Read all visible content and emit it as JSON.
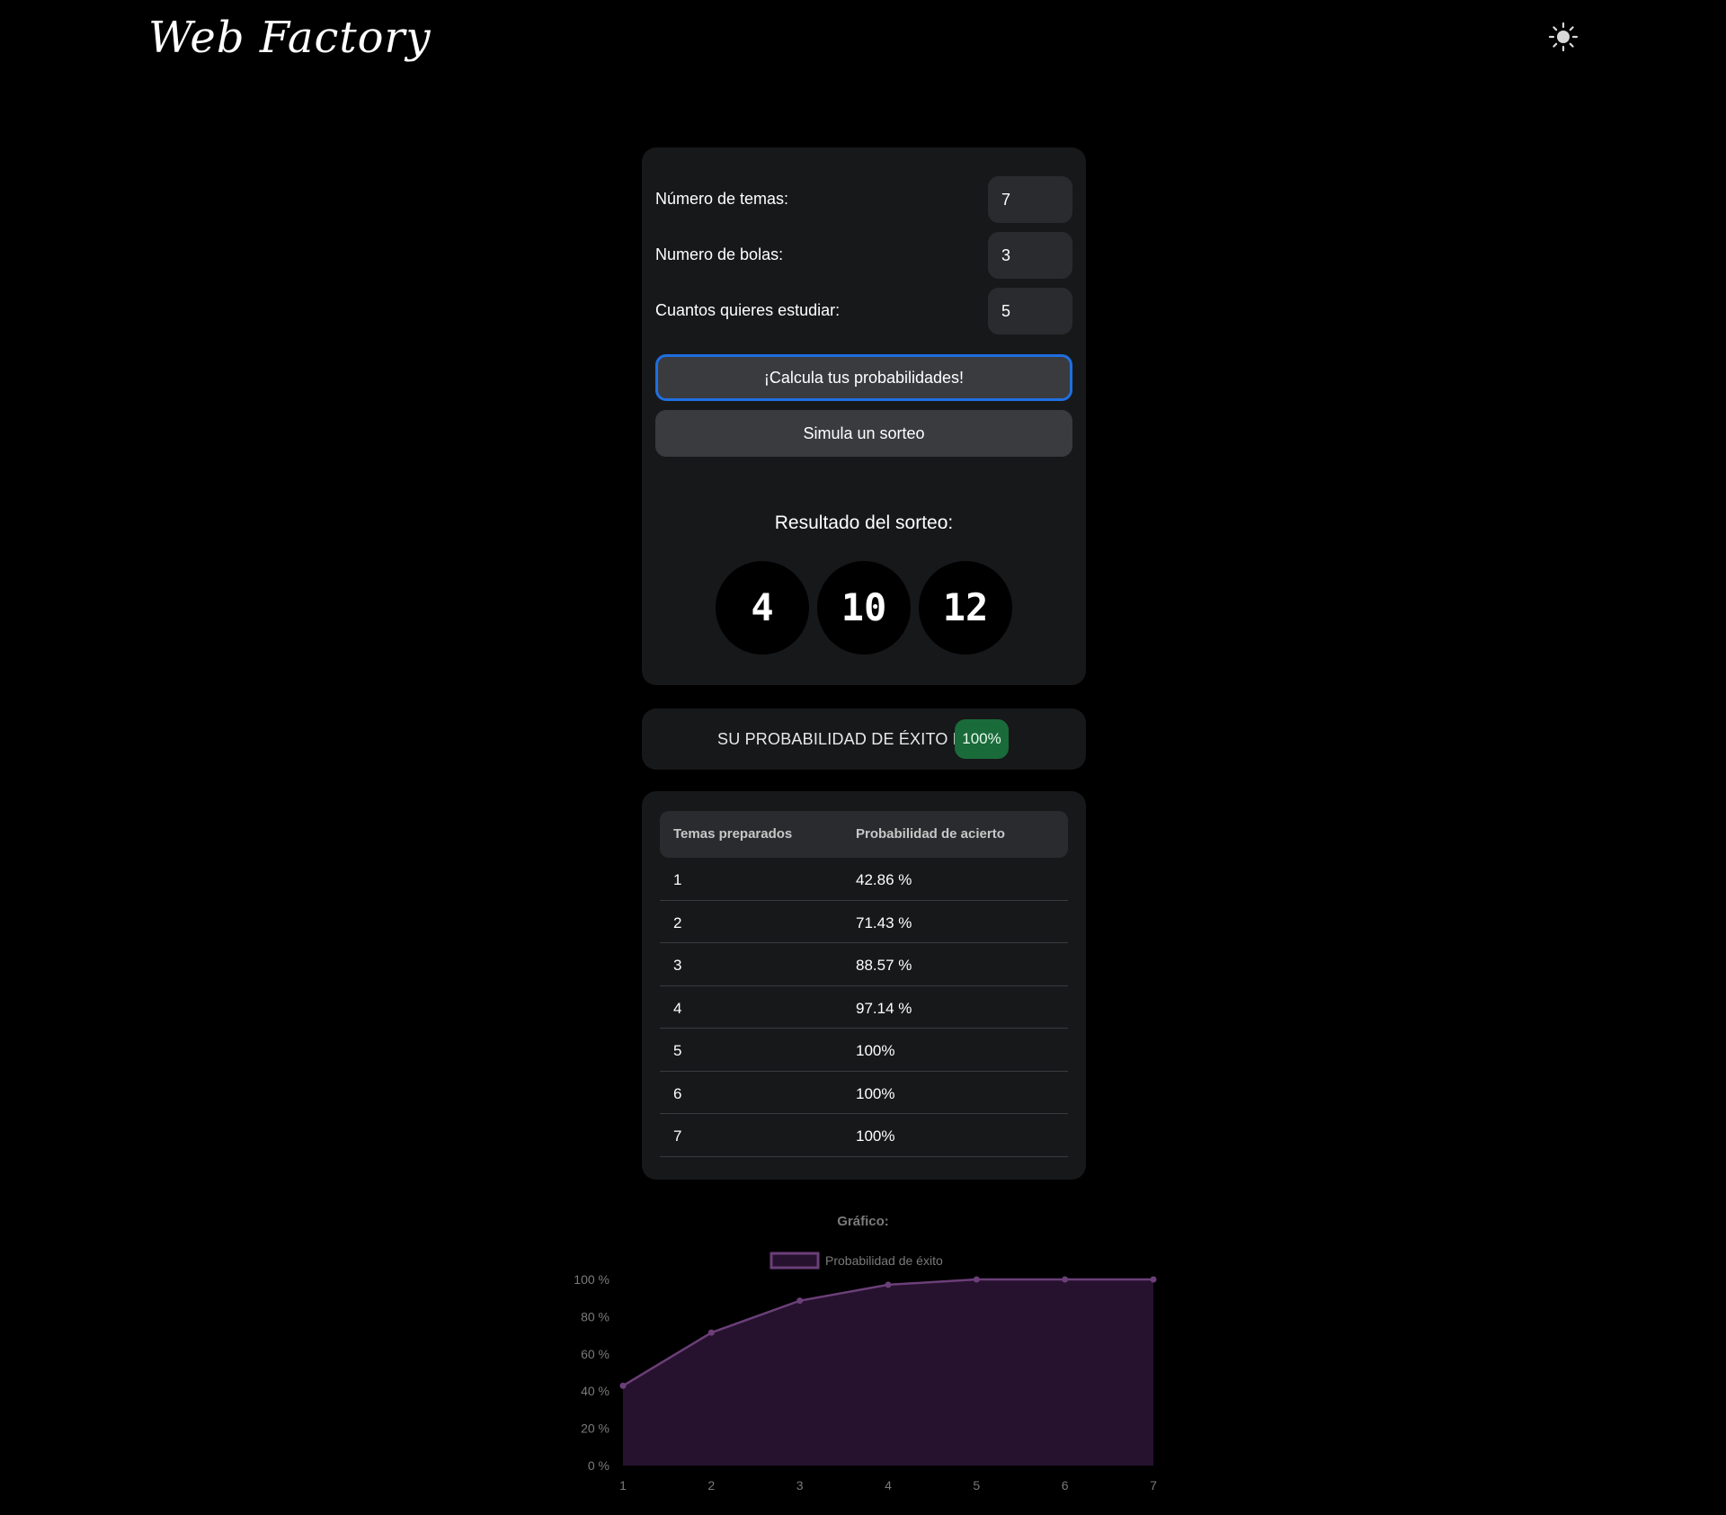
{
  "header": {
    "logo_text": "Web Factory",
    "theme_toggle_icon": "sun-icon"
  },
  "form": {
    "fields": [
      {
        "label": "Número de temas:",
        "value": "7"
      },
      {
        "label": "Numero de bolas:",
        "value": "3"
      },
      {
        "label": "Cuantos quieres estudiar:",
        "value": "5"
      }
    ],
    "calculate_label": "¡Calcula tus probabilidades!",
    "simulate_label": "Simula un sorteo",
    "accent_color": "#1f6fe0"
  },
  "draw": {
    "title": "Resultado del sorteo:",
    "balls": [
      "4",
      "10",
      "12"
    ]
  },
  "probability": {
    "label": "SU PROBABILIDAD DE ÉXITO ES:",
    "value": "100%",
    "badge_color": "#1a6b3a"
  },
  "table": {
    "headers": [
      "Temas preparados",
      "Probabilidad de acierto"
    ],
    "rows": [
      [
        "1",
        "42.86 %"
      ],
      [
        "2",
        "71.43 %"
      ],
      [
        "3",
        "88.57 %"
      ],
      [
        "4",
        "97.14 %"
      ],
      [
        "5",
        "100%"
      ],
      [
        "6",
        "100%"
      ],
      [
        "7",
        "100%"
      ]
    ]
  },
  "chart_data": {
    "type": "area",
    "title": "Gráfico:",
    "x": [
      1,
      2,
      3,
      4,
      5,
      6,
      7
    ],
    "series": [
      {
        "name": "Probabilidad de éxito",
        "values": [
          42.86,
          71.43,
          88.57,
          97.14,
          100,
          100,
          100
        ]
      }
    ],
    "ylim": [
      0,
      100
    ],
    "yticks": [
      "0 %",
      "20 %",
      "40 %",
      "60 %",
      "80 %",
      "100 %"
    ],
    "xticks": [
      "1",
      "2",
      "3",
      "4",
      "5",
      "6",
      "7"
    ],
    "grid": false,
    "legend": "top-center",
    "line_color": "#6b3f78",
    "fill_color": "#26122e"
  }
}
